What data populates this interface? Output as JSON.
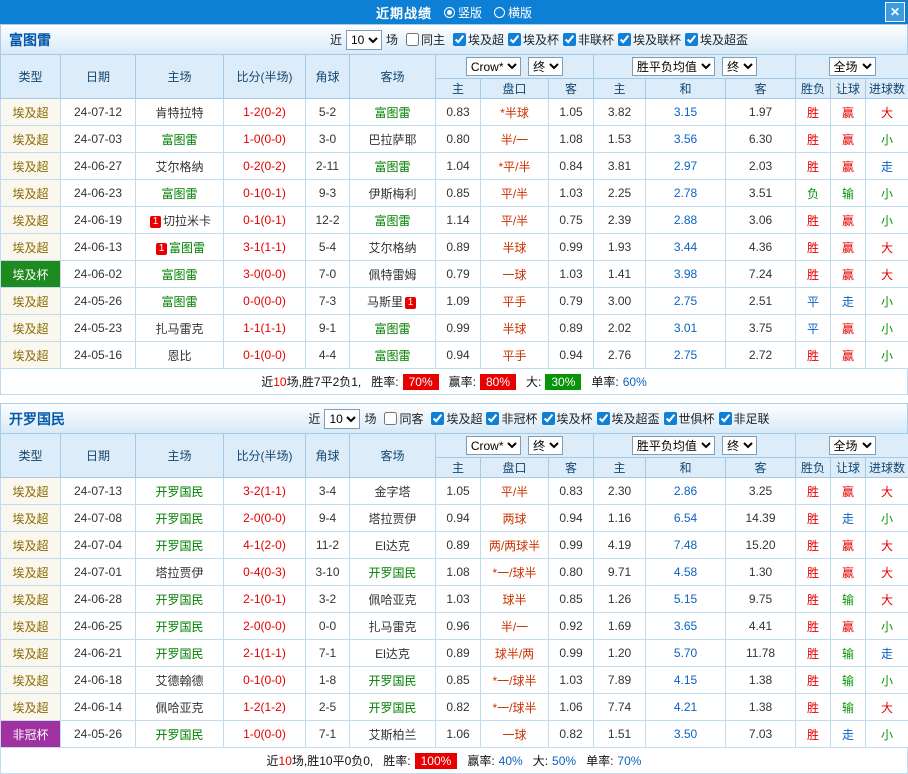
{
  "badge_label": "1",
  "titlebar": {
    "title": "近期战绩",
    "radio_vertical": "竖版",
    "radio_horizontal": "横版",
    "close": "✕"
  },
  "sections": [
    {
      "team": "富图雷",
      "filter": {
        "near_label": "近",
        "count": "10",
        "games_label": "场",
        "same_venue": {
          "label": "同主",
          "checked": false
        },
        "leagues": [
          {
            "label": "埃及超",
            "checked": true
          },
          {
            "label": "埃及杯",
            "checked": true
          },
          {
            "label": "非联杯",
            "checked": true
          },
          {
            "label": "埃及联杯",
            "checked": true
          },
          {
            "label": "埃及超盃",
            "checked": true
          }
        ]
      },
      "table": {
        "bookmaker": "Crow*",
        "ah_period": "终",
        "euro_label": "胜平负均值",
        "euro_period": "终",
        "scope": "全场",
        "cols": [
          "类型",
          "日期",
          "主场",
          "比分(半场)",
          "角球",
          "客场"
        ],
        "sub": [
          "主",
          "盘口",
          "客",
          "主",
          "和",
          "客",
          "胜负",
          "让球",
          "进球数"
        ],
        "rows": [
          {
            "type": "埃及超",
            "date": "24-07-12",
            "home": {
              "n": "肯特拉特"
            },
            "score": "1-2(0-2)",
            "corner": "5-2",
            "away": {
              "n": "富图雷",
              "f": true
            },
            "odds": [
              "0.83",
              "*半球",
              "1.05"
            ],
            "euro": [
              "3.82",
              "3.15",
              "1.97"
            ],
            "res": [
              [
                "胜",
                "r"
              ],
              [
                "赢",
                "r"
              ],
              [
                "大",
                "r"
              ]
            ]
          },
          {
            "type": "埃及超",
            "date": "24-07-03",
            "home": {
              "n": "富图雷",
              "f": true
            },
            "score": "1-0(0-0)",
            "corner": "3-0",
            "away": {
              "n": "巴拉萨耶"
            },
            "odds": [
              "0.80",
              "半/一",
              "1.08"
            ],
            "euro": [
              "1.53",
              "3.56",
              "6.30"
            ],
            "res": [
              [
                "胜",
                "r"
              ],
              [
                "赢",
                "r"
              ],
              [
                "小",
                "g"
              ]
            ]
          },
          {
            "type": "埃及超",
            "date": "24-06-27",
            "home": {
              "n": "艾尔格纳"
            },
            "score": "0-2(0-2)",
            "corner": "2-11",
            "away": {
              "n": "富图雷",
              "f": true
            },
            "odds": [
              "1.04",
              "*平/半",
              "0.84"
            ],
            "euro": [
              "3.81",
              "2.97",
              "2.03"
            ],
            "res": [
              [
                "胜",
                "r"
              ],
              [
                "赢",
                "r"
              ],
              [
                "走",
                "b"
              ]
            ]
          },
          {
            "type": "埃及超",
            "date": "24-06-23",
            "home": {
              "n": "富图雷",
              "f": true
            },
            "score": "0-1(0-1)",
            "corner": "9-3",
            "away": {
              "n": "伊斯梅利"
            },
            "odds": [
              "0.85",
              "平/半",
              "1.03"
            ],
            "euro": [
              "2.25",
              "2.78",
              "3.51"
            ],
            "res": [
              [
                "负",
                "g"
              ],
              [
                "输",
                "g"
              ],
              [
                "小",
                "g"
              ]
            ]
          },
          {
            "type": "埃及超",
            "date": "24-06-19",
            "home": {
              "n": "切拉米卡",
              "badge": "pre"
            },
            "score": "0-1(0-1)",
            "corner": "12-2",
            "away": {
              "n": "富图雷",
              "f": true
            },
            "odds": [
              "1.14",
              "平/半",
              "0.75"
            ],
            "euro": [
              "2.39",
              "2.88",
              "3.06"
            ],
            "res": [
              [
                "胜",
                "r"
              ],
              [
                "赢",
                "r"
              ],
              [
                "小",
                "g"
              ]
            ]
          },
          {
            "type": "埃及超",
            "date": "24-06-13",
            "home": {
              "n": "富图雷",
              "f": true,
              "badge": "pre"
            },
            "score": "3-1(1-1)",
            "corner": "5-4",
            "away": {
              "n": "艾尔格纳"
            },
            "odds": [
              "0.89",
              "半球",
              "0.99"
            ],
            "euro": [
              "1.93",
              "3.44",
              "4.36"
            ],
            "res": [
              [
                "胜",
                "r"
              ],
              [
                "赢",
                "r"
              ],
              [
                "大",
                "r"
              ]
            ]
          },
          {
            "type": "埃及杯",
            "tcls": "cup-green",
            "date": "24-06-02",
            "home": {
              "n": "富图雷",
              "f": true
            },
            "score": "3-0(0-0)",
            "corner": "7-0",
            "away": {
              "n": "佩特雷姆"
            },
            "odds": [
              "0.79",
              "一球",
              "1.03"
            ],
            "euro": [
              "1.41",
              "3.98",
              "7.24"
            ],
            "res": [
              [
                "胜",
                "r"
              ],
              [
                "赢",
                "r"
              ],
              [
                "大",
                "r"
              ]
            ]
          },
          {
            "type": "埃及超",
            "date": "24-05-26",
            "home": {
              "n": "富图雷",
              "f": true
            },
            "score": "0-0(0-0)",
            "corner": "7-3",
            "away": {
              "n": "马斯里",
              "badge": "post"
            },
            "odds": [
              "1.09",
              "平手",
              "0.79"
            ],
            "euro": [
              "3.00",
              "2.75",
              "2.51"
            ],
            "res": [
              [
                "平",
                "b"
              ],
              [
                "走",
                "b"
              ],
              [
                "小",
                "g"
              ]
            ]
          },
          {
            "type": "埃及超",
            "date": "24-05-23",
            "home": {
              "n": "扎马雷克"
            },
            "score": "1-1(1-1)",
            "corner": "9-1",
            "away": {
              "n": "富图雷",
              "f": true
            },
            "odds": [
              "0.99",
              "半球",
              "0.89"
            ],
            "euro": [
              "2.02",
              "3.01",
              "3.75"
            ],
            "res": [
              [
                "平",
                "b"
              ],
              [
                "赢",
                "r"
              ],
              [
                "小",
                "g"
              ]
            ]
          },
          {
            "type": "埃及超",
            "date": "24-05-16",
            "home": {
              "n": "恩比"
            },
            "score": "0-1(0-0)",
            "corner": "4-4",
            "away": {
              "n": "富图雷",
              "f": true
            },
            "odds": [
              "0.94",
              "平手",
              "0.94"
            ],
            "euro": [
              "2.76",
              "2.75",
              "2.72"
            ],
            "res": [
              [
                "胜",
                "r"
              ],
              [
                "赢",
                "r"
              ],
              [
                "小",
                "g"
              ]
            ]
          }
        ]
      },
      "footer": {
        "lead1": "近",
        "count": "10",
        "lead2": "场,胜7平2负1,",
        "stats": [
          {
            "label": "胜率:",
            "value": "70%",
            "style": "badge-red"
          },
          {
            "label": "赢率:",
            "value": "80%",
            "style": "badge-red"
          },
          {
            "label": "大:",
            "value": "30%",
            "style": "badge-green"
          },
          {
            "label": "单率:",
            "value": "60%",
            "style": "val-blue"
          }
        ]
      }
    },
    {
      "team": "开罗国民",
      "filter": {
        "near_label": "近",
        "count": "10",
        "games_label": "场",
        "same_venue": {
          "label": "同客",
          "checked": false
        },
        "leagues": [
          {
            "label": "埃及超",
            "checked": true
          },
          {
            "label": "非冠杯",
            "checked": true
          },
          {
            "label": "埃及杯",
            "checked": true
          },
          {
            "label": "埃及超盃",
            "checked": true
          },
          {
            "label": "世俱杯",
            "checked": true
          },
          {
            "label": "非足联",
            "checked": true
          }
        ]
      },
      "table": {
        "bookmaker": "Crow*",
        "ah_period": "终",
        "euro_label": "胜平负均值",
        "euro_period": "终",
        "scope": "全场",
        "cols": [
          "类型",
          "日期",
          "主场",
          "比分(半场)",
          "角球",
          "客场"
        ],
        "sub": [
          "主",
          "盘口",
          "客",
          "主",
          "和",
          "客",
          "胜负",
          "让球",
          "进球数"
        ],
        "rows": [
          {
            "type": "埃及超",
            "date": "24-07-13",
            "home": {
              "n": "开罗国民",
              "f": true
            },
            "score": "3-2(1-1)",
            "corner": "3-4",
            "away": {
              "n": "金字塔"
            },
            "odds": [
              "1.05",
              "平/半",
              "0.83"
            ],
            "euro": [
              "2.30",
              "2.86",
              "3.25"
            ],
            "res": [
              [
                "胜",
                "r"
              ],
              [
                "赢",
                "r"
              ],
              [
                "大",
                "r"
              ]
            ]
          },
          {
            "type": "埃及超",
            "date": "24-07-08",
            "home": {
              "n": "开罗国民",
              "f": true
            },
            "score": "2-0(0-0)",
            "corner": "9-4",
            "away": {
              "n": "塔拉贾伊"
            },
            "odds": [
              "0.94",
              "两球",
              "0.94"
            ],
            "euro": [
              "1.16",
              "6.54",
              "14.39"
            ],
            "res": [
              [
                "胜",
                "r"
              ],
              [
                "走",
                "b"
              ],
              [
                "小",
                "g"
              ]
            ]
          },
          {
            "type": "埃及超",
            "date": "24-07-04",
            "home": {
              "n": "开罗国民",
              "f": true
            },
            "score": "4-1(2-0)",
            "corner": "11-2",
            "away": {
              "n": "El达克"
            },
            "odds": [
              "0.89",
              "两/两球半",
              "0.99"
            ],
            "euro": [
              "4.19",
              "7.48",
              "15.20"
            ],
            "res": [
              [
                "胜",
                "r"
              ],
              [
                "赢",
                "r"
              ],
              [
                "大",
                "r"
              ]
            ]
          },
          {
            "type": "埃及超",
            "date": "24-07-01",
            "home": {
              "n": "塔拉贾伊"
            },
            "score": "0-4(0-3)",
            "corner": "3-10",
            "away": {
              "n": "开罗国民",
              "f": true
            },
            "odds": [
              "1.08",
              "*一/球半",
              "0.80"
            ],
            "euro": [
              "9.71",
              "4.58",
              "1.30"
            ],
            "res": [
              [
                "胜",
                "r"
              ],
              [
                "赢",
                "r"
              ],
              [
                "大",
                "r"
              ]
            ]
          },
          {
            "type": "埃及超",
            "date": "24-06-28",
            "home": {
              "n": "开罗国民",
              "f": true
            },
            "score": "2-1(0-1)",
            "corner": "3-2",
            "away": {
              "n": "佩哈亚克"
            },
            "odds": [
              "1.03",
              "球半",
              "0.85"
            ],
            "euro": [
              "1.26",
              "5.15",
              "9.75"
            ],
            "res": [
              [
                "胜",
                "r"
              ],
              [
                "输",
                "g"
              ],
              [
                "大",
                "r"
              ]
            ]
          },
          {
            "type": "埃及超",
            "date": "24-06-25",
            "home": {
              "n": "开罗国民",
              "f": true
            },
            "score": "2-0(0-0)",
            "corner": "0-0",
            "away": {
              "n": "扎马雷克"
            },
            "odds": [
              "0.96",
              "半/一",
              "0.92"
            ],
            "euro": [
              "1.69",
              "3.65",
              "4.41"
            ],
            "res": [
              [
                "胜",
                "r"
              ],
              [
                "赢",
                "r"
              ],
              [
                "小",
                "g"
              ]
            ]
          },
          {
            "type": "埃及超",
            "date": "24-06-21",
            "home": {
              "n": "开罗国民",
              "f": true
            },
            "score": "2-1(1-1)",
            "corner": "7-1",
            "away": {
              "n": "El达克"
            },
            "odds": [
              "0.89",
              "球半/两",
              "0.99"
            ],
            "euro": [
              "1.20",
              "5.70",
              "11.78"
            ],
            "res": [
              [
                "胜",
                "r"
              ],
              [
                "输",
                "g"
              ],
              [
                "走",
                "b"
              ]
            ]
          },
          {
            "type": "埃及超",
            "date": "24-06-18",
            "home": {
              "n": "艾德翰德"
            },
            "score": "0-1(0-0)",
            "corner": "1-8",
            "away": {
              "n": "开罗国民",
              "f": true
            },
            "odds": [
              "0.85",
              "*一/球半",
              "1.03"
            ],
            "euro": [
              "7.89",
              "4.15",
              "1.38"
            ],
            "res": [
              [
                "胜",
                "r"
              ],
              [
                "输",
                "g"
              ],
              [
                "小",
                "g"
              ]
            ]
          },
          {
            "type": "埃及超",
            "date": "24-06-14",
            "home": {
              "n": "佩哈亚克"
            },
            "score": "1-2(1-2)",
            "corner": "2-5",
            "away": {
              "n": "开罗国民",
              "f": true
            },
            "odds": [
              "0.82",
              "*一/球半",
              "1.06"
            ],
            "euro": [
              "7.74",
              "4.21",
              "1.38"
            ],
            "res": [
              [
                "胜",
                "r"
              ],
              [
                "输",
                "g"
              ],
              [
                "大",
                "r"
              ]
            ]
          },
          {
            "type": "非冠杯",
            "tcls": "cup-purple",
            "date": "24-05-26",
            "home": {
              "n": "开罗国民",
              "f": true
            },
            "score": "1-0(0-0)",
            "corner": "7-1",
            "away": {
              "n": "艾斯柏兰"
            },
            "odds": [
              "1.06",
              "一球",
              "0.82"
            ],
            "euro": [
              "1.51",
              "3.50",
              "7.03"
            ],
            "res": [
              [
                "胜",
                "r"
              ],
              [
                "走",
                "b"
              ],
              [
                "小",
                "g"
              ]
            ]
          }
        ]
      },
      "footer": {
        "lead1": "近",
        "count": "10",
        "lead2": "场,胜10平0负0,",
        "stats": [
          {
            "label": "胜率:",
            "value": "100%",
            "style": "badge-red"
          },
          {
            "label": "赢率:",
            "value": "40%",
            "style": "val-blue"
          },
          {
            "label": "大:",
            "value": "50%",
            "style": "val-blue"
          },
          {
            "label": "单率:",
            "value": "70%",
            "style": "val-blue"
          }
        ]
      }
    }
  ]
}
